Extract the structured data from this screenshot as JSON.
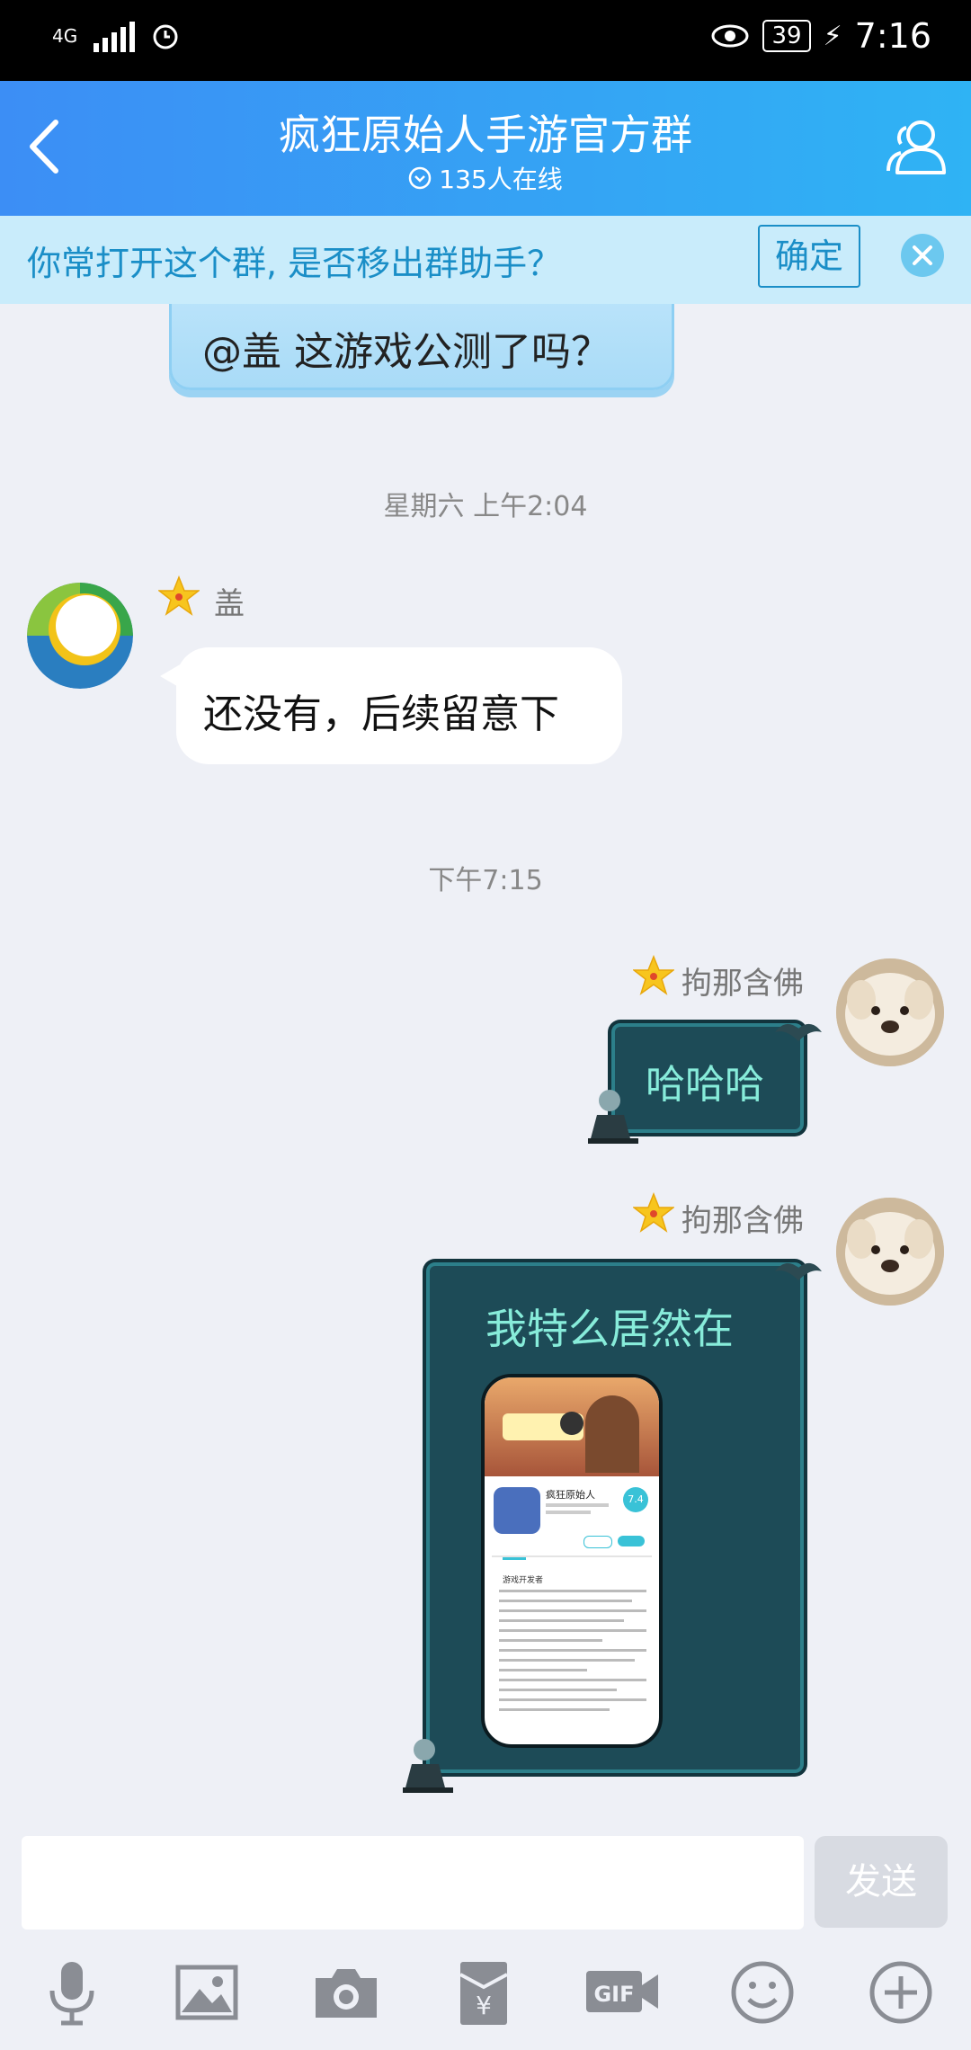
{
  "status_bar": {
    "network": "4G",
    "battery": "39",
    "time": "7:16"
  },
  "header": {
    "title": "疯狂原始人手游官方群",
    "online": "135人在线"
  },
  "notice": {
    "text": "你常打开这个群, 是否移出群助手？",
    "confirm_label": "确定"
  },
  "messages": {
    "prev_text": "@盖 这游戏公测了吗？",
    "time1": "星期六 上午2:04",
    "msg1_sender": "盖",
    "msg1_text": "还没有，后续留意下",
    "time2": "下午7:15",
    "msg2_sender": "拘那含佛",
    "msg2_text": "哈哈哈",
    "msg3_sender": "拘那含佛",
    "msg3_text": "我特么居然在"
  },
  "screenshot_card": {
    "app_name": "疯狂原始人",
    "rating": "7.4",
    "section_title": "游戏开发者"
  },
  "input_bar": {
    "placeholder": "",
    "send_label": "发送"
  },
  "icons": [
    "mic-icon",
    "image-icon",
    "camera-icon",
    "red-packet-icon",
    "gif-icon",
    "emoji-icon",
    "plus-icon"
  ]
}
